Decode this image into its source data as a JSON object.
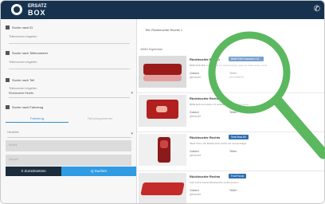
{
  "header": {
    "brand_top": "ERSATZ",
    "brand_main": "BOX"
  },
  "left": {
    "sections": [
      {
        "label": "Suche nach ID"
      },
      {
        "label": "Suche nach Teilenummer"
      },
      {
        "label": "Suche nach Teil"
      },
      {
        "label": "Suche nach Fahrzeug"
      }
    ],
    "fields": [
      {
        "label": "Teilenummer eingeben"
      },
      {
        "label": "Teilenummer eingeben"
      },
      {
        "label": "Teilenummer eingeben"
      },
      {
        "label": "Rückleuchte Rechts"
      }
    ],
    "tabs": [
      "Fahrzeug",
      "Fahrzeugnummer"
    ],
    "selects": [
      "Hersteller",
      "Modell",
      "Baujahr"
    ],
    "buttons": {
      "clear": "X  Zurücksetzen",
      "search": "Q  Suchen"
    }
  },
  "right": {
    "title": "Teil: Rückleuchte Rechts  ×",
    "results_label": "46563 Ergebnisse",
    "cards": [
      {
        "title": "Rückleuchte Rechts",
        "badge": "BMW E46 Limousine 1.8 ..",
        "desc": "BMW E46 316i / Limousine 1.9 Gebrauchtteil passend rückleuchte rechts",
        "k1": "Zustand",
        "v1": "gebraucht",
        "k2": "Teilenr.",
        "v2": "6913389030"
      },
      {
        "title": "Rückleuchte Rechts",
        "badge": "",
        "desc": "BMW E46 Limousine 1.9 Gebrauchtteil mit Glasnummer",
        "k1": "Zustand",
        "v1": "gebraucht",
        "k2": "Teilenr.",
        "v2": "-"
      },
      {
        "title": "Rückleuchte Rechts",
        "badge": "Seat Ibiza 6K",
        "desc": "SEAT Ibiza / 6K Rückleuchte rechts mit Lampenträger",
        "k1": "Zustand",
        "v1": "gebraucht",
        "k2": "Teilenr.",
        "v2": "-"
      },
      {
        "title": "Rückleuchte Rechts",
        "badge": "Ford Focus",
        "desc": "Ford Focus Kombi Rückleuchte rechts aussen",
        "k1": "Zustand",
        "v1": "gebraucht",
        "k2": "Teilenr.",
        "v2": "-"
      }
    ]
  }
}
